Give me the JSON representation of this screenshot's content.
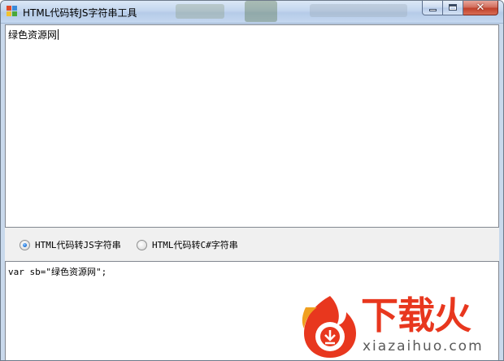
{
  "window": {
    "title": "HTML代码转JS字符串工具",
    "caption_buttons": {
      "minimize": "—",
      "maximize": "□",
      "close": "✕"
    }
  },
  "input": {
    "value": "绿色资源网"
  },
  "options": [
    {
      "label": "HTML代码转JS字符串",
      "selected": true
    },
    {
      "label": "HTML代码转C#字符串",
      "selected": false
    }
  ],
  "output": {
    "value": "var sb=\"绿色资源网\";"
  },
  "watermark": {
    "brand_cn": "下载火",
    "brand_en": "xiazaihuo.com"
  },
  "colors": {
    "accent_red": "#e8371e",
    "radio_selected": "#2a7ee0",
    "titlebar": "#c3d6ee"
  }
}
